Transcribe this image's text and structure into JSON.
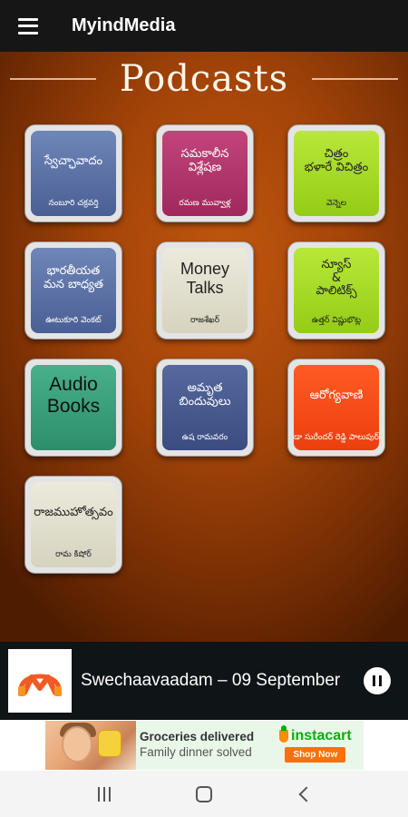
{
  "appbar": {
    "title": "MyindMedia",
    "menu_icon": "hamburger-menu-icon"
  },
  "page": {
    "title": "Podcasts"
  },
  "tiles": [
    {
      "title": "స్వేచ్ఛావాదం",
      "subtitle": "నంబూరి చక్రవర్తి",
      "color": "#5a70a6"
    },
    {
      "title": "సమకాలీన\nవిశ్లేషణ",
      "subtitle": "రమణ మువ్వాళ్ల",
      "color": "#b2376a"
    },
    {
      "title": "చిత్రం\nభళారే విచిత్రం",
      "subtitle": "వెన్నెల",
      "color": "#a6db28"
    },
    {
      "title": "భారతీయత\nమన బాధ్యత",
      "subtitle": "ఊటుకూరి వెంకట్",
      "color": "#5a70a6"
    },
    {
      "title": "Money\nTalks",
      "subtitle": "రాజశేఖర్",
      "color": "#e1dece"
    },
    {
      "title": "న్యూస్\n&\nపాలిటిక్స్",
      "subtitle": "ఉత్తర్ విష్ణుభొట్ల",
      "color": "#a6db28"
    },
    {
      "title": "Audio\nBooks",
      "subtitle": "",
      "color": "#3a9f7b"
    },
    {
      "title": "అమృత\nబిందువులు",
      "subtitle": "ఉష రామవరం",
      "color": "#48598f"
    },
    {
      "title": "ఆరోగ్యవాణి",
      "subtitle": "డా సురేందర్ రెడ్డి పాలుపుర్",
      "color": "#f54b19"
    },
    {
      "title": "రాజముహోత్సవం",
      "subtitle": "రామ కిషోర్",
      "color": "#e1dece"
    }
  ],
  "player": {
    "track_title": "Swechaavaadam – 09 September",
    "art_icon": "myindmedia-logo-icon",
    "pause_icon": "pause-icon"
  },
  "ad": {
    "headline": "Groceries delivered",
    "subline": "Family dinner solved",
    "brand": "instacart",
    "cta": "Shop Now"
  },
  "navbar": {
    "recents_icon": "recents-icon",
    "home_icon": "home-icon",
    "back_icon": "back-icon"
  }
}
